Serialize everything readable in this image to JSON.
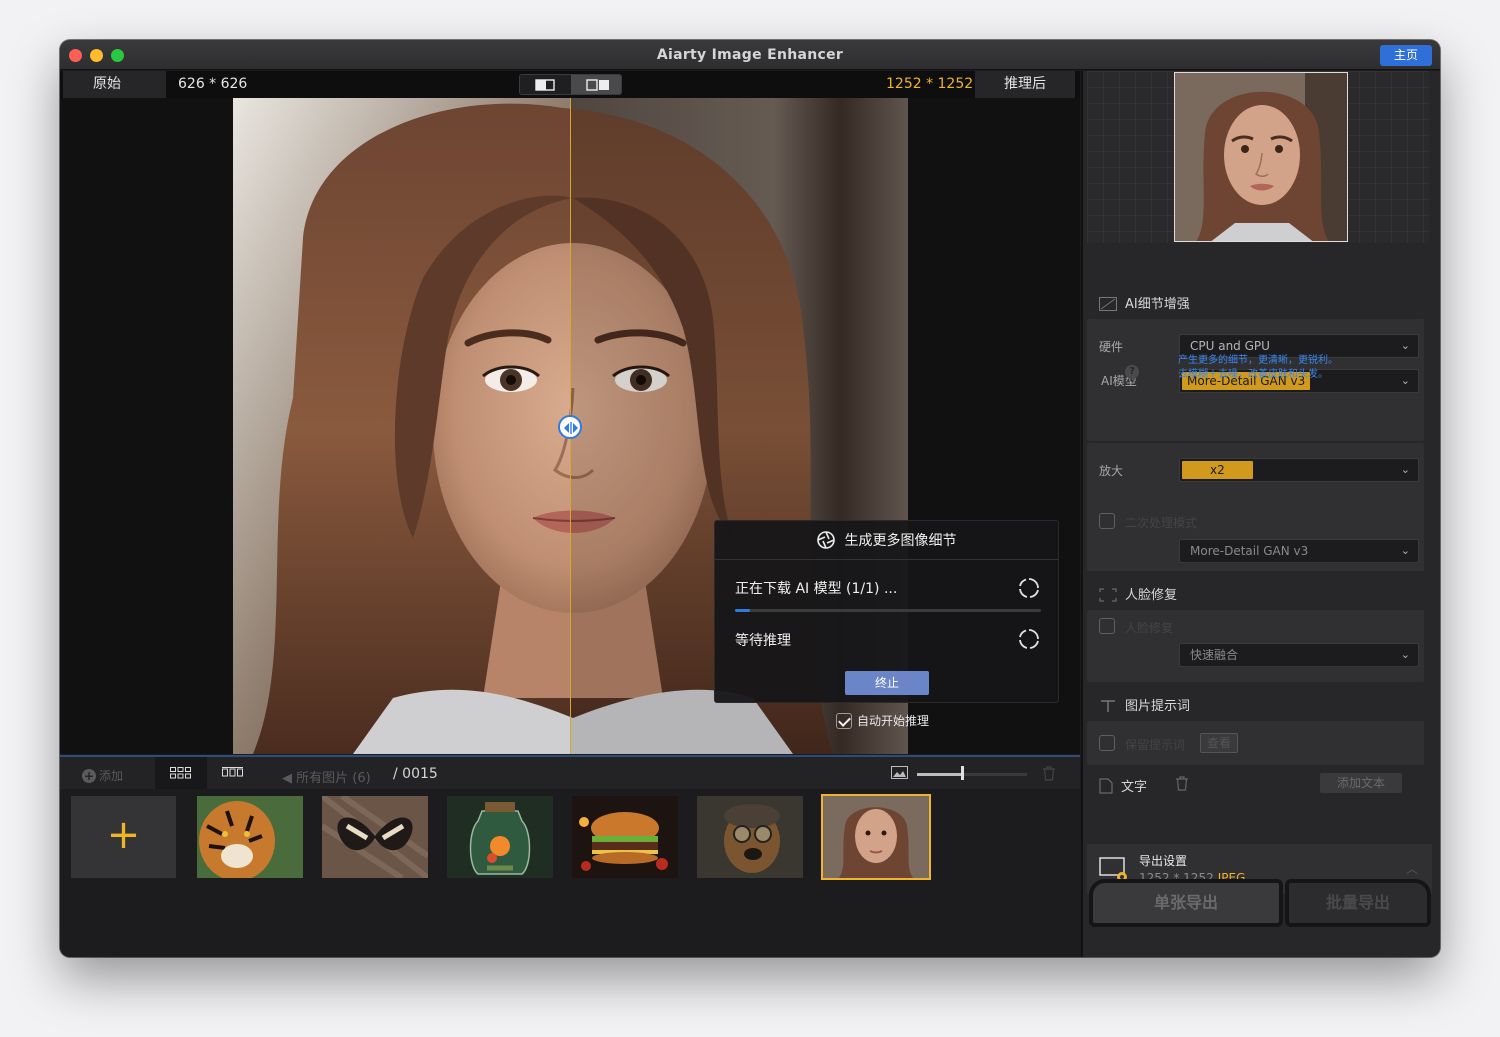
{
  "window": {
    "title": "Aiarty Image Enhancer",
    "home_label": "主页"
  },
  "infobar": {
    "left_label": "原始",
    "left_size": "626 * 626",
    "right_size": "1252 * 1252",
    "right_label": "推理后"
  },
  "progress": {
    "header": "生成更多图像细节",
    "step1": "正在下载 AI 模型 (1/1) ...",
    "step1_fraction": 0.05,
    "step2": "等待推理",
    "stop_label": "终止",
    "auto_start_label": "自动开始推理",
    "auto_start_checked": true
  },
  "toolbar": {
    "add_label": "添加",
    "all_images_label": "所有图片 (6)",
    "count_label": "/ 0015",
    "zoom_fraction": 0.4
  },
  "thumbnails": [
    {
      "name": "tiger"
    },
    {
      "name": "butterfly"
    },
    {
      "name": "jar"
    },
    {
      "name": "burger"
    },
    {
      "name": "steampunk-dog"
    },
    {
      "name": "woman-portrait",
      "selected": true
    }
  ],
  "panel": {
    "ai_detail_title": "AI细节增强",
    "hardware_label": "硬件",
    "hardware_value": "CPU and GPU",
    "model_label": "AI模型",
    "model_value": "More-Detail GAN v3",
    "model_desc_1": "产生更多的细节，更清晰，更锐利。",
    "model_desc_2": "去模糊＋去噪，改善皮肤和头发。",
    "help_label": "?",
    "upscale_label": "放大",
    "upscale_value": "x2",
    "second_pass_label": "二次处理模式",
    "second_pass_value": "More-Detail GAN v3",
    "face_title": "人脸修复",
    "face_check_label": "人脸修复",
    "face_value": "快速融合",
    "prompt_title": "图片提示词",
    "prompt_check_label": "保留提示词",
    "view_label": "查看",
    "text_label": "文字",
    "add_text_label": "添加文本",
    "export_title": "导出设置",
    "export_size": "1252 * 1252",
    "export_format": "JPEG",
    "single_export": "单张导出",
    "batch_export": "批量导出"
  },
  "colors": {
    "accent_blue": "#2f6fd8",
    "accent_gold": "#f0b429",
    "background": "#1c1c1e"
  }
}
